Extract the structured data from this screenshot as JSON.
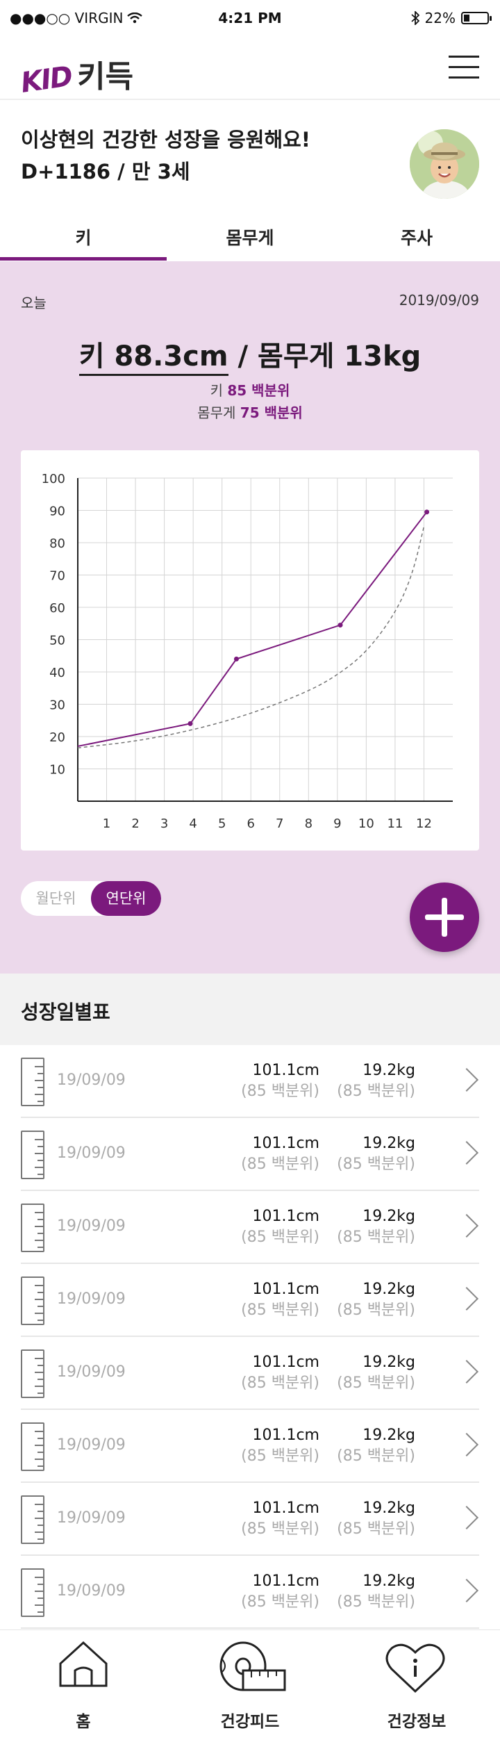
{
  "status_bar": {
    "carrier": "●●●○○ VIRGIN",
    "time": "4:21 PM",
    "battery": "22%"
  },
  "header": {
    "logo_en": "KID",
    "logo_ko": "키득"
  },
  "greeting": {
    "line1": "이상현의 건강한 성장을 응원해요!",
    "line2": "D+1186 / 만 3세"
  },
  "tabs": [
    {
      "label": "키"
    },
    {
      "label": "몸무게"
    },
    {
      "label": "주사"
    }
  ],
  "summary": {
    "today_label": "오늘",
    "date": "2019/09/09",
    "height_text": "키 88.3cm",
    "separator": " / ",
    "weight_text": "몸무게 13kg",
    "height_pct_label": "키",
    "height_pct_value": "85 백분위",
    "weight_pct_label": "몸무게",
    "weight_pct_value": "75 백분위"
  },
  "toggle": {
    "monthly": "월단위",
    "yearly": "연단위",
    "active": "yearly"
  },
  "chart_data": {
    "type": "line",
    "x": [
      1,
      2,
      3,
      4,
      5,
      6,
      7,
      8,
      9,
      10,
      11,
      12
    ],
    "x_ticks": [
      "1",
      "2",
      "3",
      "4",
      "5",
      "6",
      "7",
      "8",
      "9",
      "10",
      "11",
      "12"
    ],
    "y_ticks": [
      "10",
      "20",
      "30",
      "40",
      "50",
      "60",
      "70",
      "80",
      "90",
      "100"
    ],
    "ylim": [
      0,
      100
    ],
    "xlim": [
      0,
      13
    ],
    "grid": true,
    "series": [
      {
        "style": "solid",
        "color": "#7b1a7d",
        "points": [
          [
            0,
            17
          ],
          [
            3.9,
            24
          ],
          [
            5.5,
            44
          ],
          [
            9.1,
            54.5
          ],
          [
            12.1,
            89.5
          ]
        ],
        "markers": [
          [
            3.9,
            24
          ],
          [
            5.5,
            44
          ],
          [
            9.1,
            54.5
          ],
          [
            12.1,
            89.5
          ]
        ]
      },
      {
        "style": "dashed",
        "color": "#777777",
        "points": [
          [
            0,
            16.5
          ],
          [
            2,
            18.5
          ],
          [
            4,
            22
          ],
          [
            6,
            27
          ],
          [
            8,
            34
          ],
          [
            9,
            39
          ],
          [
            10,
            46
          ],
          [
            11,
            58
          ],
          [
            11.6,
            70
          ],
          [
            12,
            85
          ]
        ]
      }
    ]
  },
  "table": {
    "title": "성장일별표",
    "rows": [
      {
        "date": "19/09/09",
        "height": "101.1cm",
        "height_pct": "(85 백분위)",
        "weight": "19.2kg",
        "weight_pct": "(85 백분위)"
      },
      {
        "date": "19/09/09",
        "height": "101.1cm",
        "height_pct": "(85 백분위)",
        "weight": "19.2kg",
        "weight_pct": "(85 백분위)"
      },
      {
        "date": "19/09/09",
        "height": "101.1cm",
        "height_pct": "(85 백분위)",
        "weight": "19.2kg",
        "weight_pct": "(85 백분위)"
      },
      {
        "date": "19/09/09",
        "height": "101.1cm",
        "height_pct": "(85 백분위)",
        "weight": "19.2kg",
        "weight_pct": "(85 백분위)"
      },
      {
        "date": "19/09/09",
        "height": "101.1cm",
        "height_pct": "(85 백분위)",
        "weight": "19.2kg",
        "weight_pct": "(85 백분위)"
      },
      {
        "date": "19/09/09",
        "height": "101.1cm",
        "height_pct": "(85 백분위)",
        "weight": "19.2kg",
        "weight_pct": "(85 백분위)"
      },
      {
        "date": "19/09/09",
        "height": "101.1cm",
        "height_pct": "(85 백분위)",
        "weight": "19.2kg",
        "weight_pct": "(85 백분위)"
      },
      {
        "date": "19/09/09",
        "height": "101.1cm",
        "height_pct": "(85 백분위)",
        "weight": "19.2kg",
        "weight_pct": "(85 백분위)"
      }
    ]
  },
  "bottom_nav": [
    {
      "label": "홈",
      "icon": "home-icon"
    },
    {
      "label": "건강피드",
      "icon": "tape-measure-icon"
    },
    {
      "label": "건강정보",
      "icon": "heart-info-icon"
    }
  ],
  "colors": {
    "accent": "#7b1a7d",
    "pink_bg": "#ecd9eb",
    "text": "#222222",
    "muted": "#aaaaaa"
  }
}
